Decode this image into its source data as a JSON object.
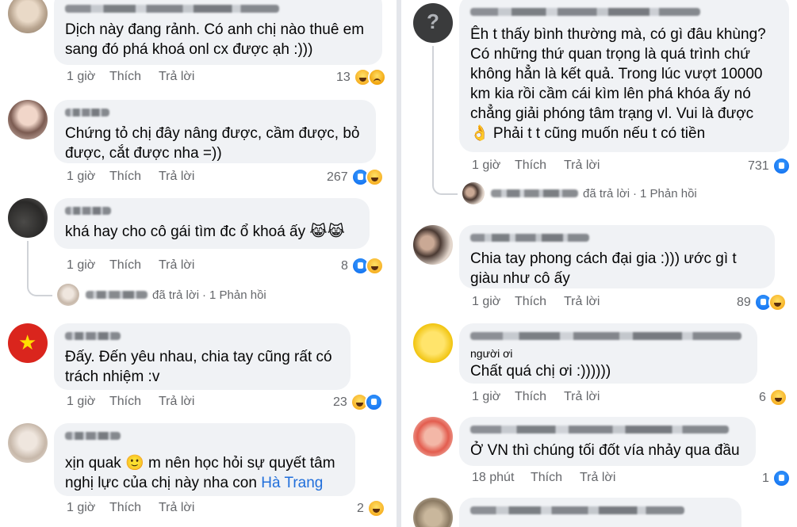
{
  "left": {
    "comments": [
      {
        "text": "Dịch này đang rảnh. Có anh chị nào thuê em\nsang đó phá khoá onl cx được ạh :)))",
        "time": "1 giờ",
        "like": "Thích",
        "reply": "Trả lời",
        "reactions": {
          "count": "13",
          "icons": [
            "haha",
            "sad"
          ]
        }
      },
      {
        "text": "Chứng tỏ chị đây nâng được, cầm được, bỏ\nđược, cắt được nha =))",
        "time": "1 giờ",
        "like": "Thích",
        "reply": "Trả lời",
        "reactions": {
          "count": "267",
          "icons": [
            "like",
            "haha"
          ]
        }
      },
      {
        "text": "khá hay cho cô gái tìm đc ổ khoá ấy 😹😹",
        "time": "1 giờ",
        "like": "Thích",
        "reply": "Trả lời",
        "reactions": {
          "count": "8",
          "icons": [
            "like",
            "haha"
          ]
        },
        "reply_summary": {
          "replied": "đã trả lời",
          "count": "1 Phản hồi"
        }
      },
      {
        "text": "Đấy. Đến yêu nhau, chia tay cũng rất có\ntrách nhiệm :v",
        "time": "1 giờ",
        "like": "Thích",
        "reply": "Trả lời",
        "reactions": {
          "count": "23",
          "icons": [
            "haha",
            "like"
          ]
        }
      },
      {
        "text_before": "xịn quak ",
        "text_emoji": "🙂",
        "text_after": " m nên học hỏi sự quyết tâm\nnghị lực của chị này nha con ",
        "tag": "Hà Trang",
        "time": "1 giờ",
        "like": "Thích",
        "reply": "Trả lời",
        "reactions": {
          "count": "2",
          "icons": [
            "haha"
          ]
        }
      }
    ]
  },
  "right": {
    "comments": [
      {
        "text": "Êh t thấy bình thường mà, có gì đâu khùng?\nCó những thứ quan trọng là quá trình chứ\nkhông hẳn là kết quả. Trong lúc vượt 10000\nkm kia rồi cầm cái kìm lên phá khóa ấy nó\nchẳng giải phóng tâm trạng vl. Vui là được\n👌 Phải t t cũng muốn nếu t có tiền",
        "time": "1 giờ",
        "like": "Thích",
        "reply": "Trả lời",
        "reactions": {
          "count": "731",
          "icons": [
            "like"
          ]
        },
        "reply_summary": {
          "replied": "đã trả lời",
          "count": "1 Phản hồi"
        }
      },
      {
        "text": "Chia tay phong cách đại gia :)))  ước gì t\ngiàu như cô ấy",
        "time": "1 giờ",
        "like": "Thích",
        "reply": "Trả lời",
        "reactions": {
          "count": "89",
          "icons": [
            "like",
            "haha"
          ]
        }
      },
      {
        "subname": "người ơi",
        "text": "Chất quá chị ơi :))))))",
        "time": "1 giờ",
        "like": "Thích",
        "reply": "Trả lời",
        "reactions": {
          "count": "6",
          "icons": [
            "haha"
          ]
        }
      },
      {
        "text": "Ở VN thì chúng tối đốt vía nhảy qua đầu",
        "time": "18 phút",
        "like": "Thích",
        "reply": "Trả lời",
        "reactions": {
          "count": "1",
          "icons": [
            "like"
          ]
        }
      }
    ]
  }
}
